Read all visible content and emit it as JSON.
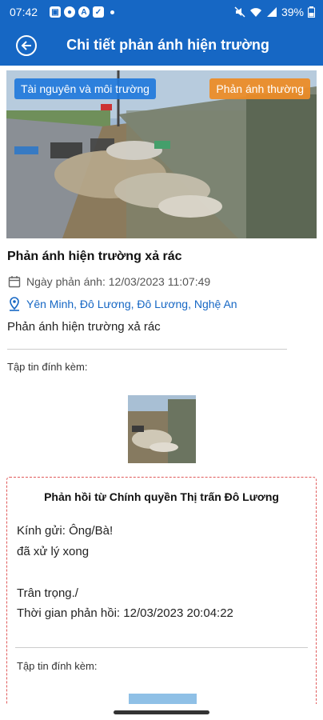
{
  "status_bar": {
    "time": "07:42",
    "battery": "39%",
    "icons": [
      "gallery-icon",
      "messenger-icon",
      "a-icon",
      "check-icon"
    ]
  },
  "header": {
    "title": "Chi tiết phản ánh hiện trường"
  },
  "hero": {
    "category_tag": "Tài nguyên và môi trường",
    "type_tag": "Phản ánh thường"
  },
  "report": {
    "title": "Phản ánh hiện trường xả rác",
    "date_text": "Ngày phản ánh: 12/03/2023 11:07:49",
    "location": "Yên Minh, Đô Lương, Đô Lương, Nghệ An",
    "description": "Phản ánh hiện trường xả rác",
    "attachments_label": "Tập tin đính kèm:"
  },
  "response": {
    "title": "Phản hồi từ Chính quyền Thị trấn Đô Lương",
    "greeting": "Kính gửi: Ông/Bà!",
    "message": "đã xử lý xong",
    "closing": "Trân trọng./",
    "time_text": "Thời gian phản hồi:  12/03/2023 20:04:22",
    "attachments_label": "Tập tin đính kèm:"
  },
  "colors": {
    "primary": "#1667c4",
    "tag_blue": "#1e78dc",
    "tag_orange": "#eb8c28",
    "dashed_border": "#e05a5a"
  }
}
